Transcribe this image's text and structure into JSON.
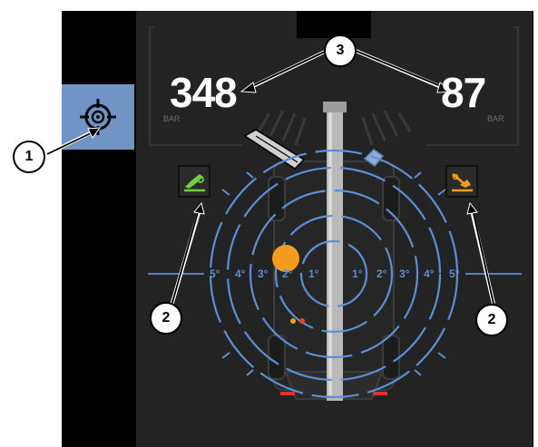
{
  "side_button": {
    "icon": "crosshair-target-icon"
  },
  "pressure": {
    "left": {
      "value": "348",
      "unit": "BAR"
    },
    "right": {
      "value": "87",
      "unit": "BAR"
    }
  },
  "tilt_scale": {
    "left_labels": [
      "5°",
      "4°",
      "3°",
      "2°",
      "1°"
    ],
    "right_labels": [
      "1°",
      "2°",
      "3°",
      "4°",
      "5°"
    ]
  },
  "callouts": {
    "c1": "1",
    "c2_left": "2",
    "c2_right": "2",
    "c3": "3"
  },
  "colors": {
    "panel": "#232323",
    "ring": "#5b8fd6",
    "indicator": "#f39c1e",
    "active_green": "#6fd13b",
    "active_orange": "#f39c1e",
    "side_button": "#7094c6"
  }
}
